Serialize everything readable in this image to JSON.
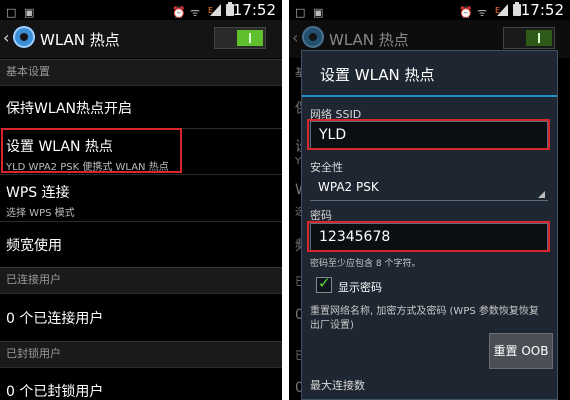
{
  "status_bar": {
    "time": "17:52",
    "vibrate_icon": "□",
    "image_icon": "▣",
    "alarm_icon": "⏰",
    "wifi_icon": "ᯤ"
  },
  "left": {
    "header": {
      "back_icon": "‹",
      "title": "WLAN 热点"
    },
    "sections": {
      "basic": "基本设置",
      "connected": "已连接用户",
      "blocked": "已封锁用户"
    },
    "items": {
      "keep_on": "保持WLAN热点开启",
      "configure_title": "设置 WLAN 热点",
      "configure_sub": "YLD WPA2 PSK 便携式 WLAN 热点",
      "wps_title": "WPS 连接",
      "wps_sub": "选择 WPS 模式",
      "bandwidth": "频宽使用",
      "connected_count": "0 个已连接用户",
      "blocked_count": "0 个已封锁用户"
    }
  },
  "right": {
    "bg_title": "WLAN 热点",
    "bg_chars": [
      "基",
      "保",
      "设",
      "Y",
      "W",
      "选",
      "频",
      "已",
      "0",
      "已",
      "0"
    ],
    "dialog": {
      "title": "设置 WLAN 热点",
      "ssid_label": "网络 SSID",
      "ssid_value": "YLD",
      "security_label": "安全性",
      "security_value": "WPA2 PSK",
      "password_label": "密码",
      "password_value": "12345678",
      "password_hint": "密码至少应包含 8 个字符。",
      "show_password_label": "显示密码",
      "reset_desc": "重置网络名称, 加密方式及密码 (WPS 参数恢复恢复出厂设置)",
      "reset_button": "重置 OOB",
      "max_conn_label": "最大连接数"
    }
  },
  "colors": {
    "highlight_red": "#d8262d",
    "toggle_on": "#5fbf2d",
    "accent_blue": "#1f8fd0"
  }
}
